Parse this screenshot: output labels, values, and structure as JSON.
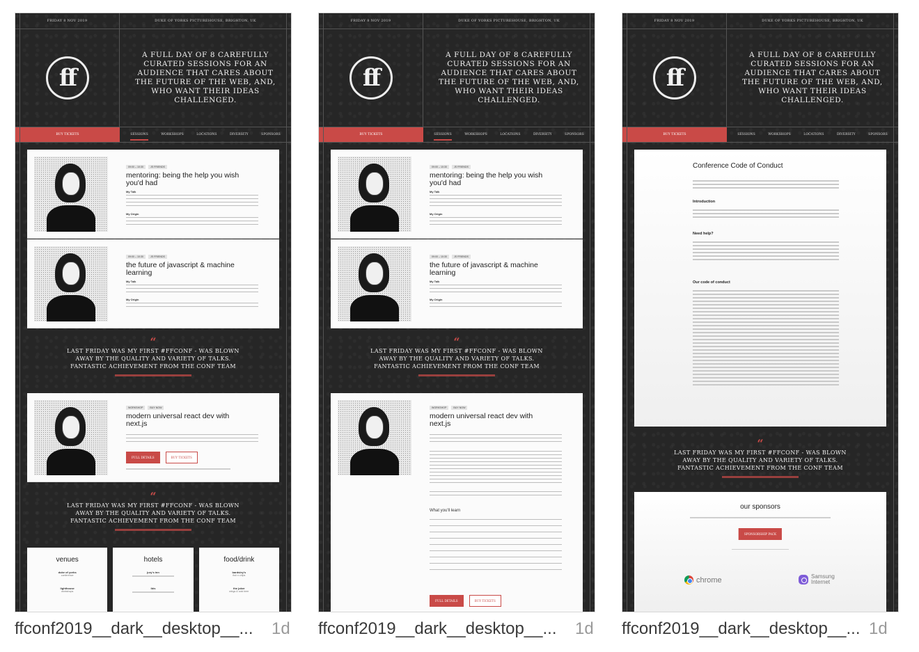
{
  "site": {
    "date": "FRIDAY 8 NOV 2019",
    "venue": "DUKE OF YORKS PICTUREHOUSE, BRIGHTON, UK",
    "logo": "ff",
    "tagline": "A FULL DAY OF 8 CAREFULLY CURATED SESSIONS FOR AN AUDIENCE THAT CARES ABOUT THE FUTURE OF THE WEB, AND, WHO WANT THEIR IDEAS CHALLENGED.",
    "buy_tickets": "BUY TICKETS",
    "nav": [
      "SESSIONS",
      "WORKSHOPS",
      "LOCATIONS",
      "DIVERSITY",
      "SPONSORS"
    ]
  },
  "talks": [
    {
      "tags": [
        "09:00 – 10:30",
        "JS FRIENDS"
      ],
      "title": "mentoring: being the help you wish you'd had",
      "talk_label": "My Talk",
      "origin_label": "My Origin"
    },
    {
      "tags": [
        "09:00 – 10:30",
        "JS FRIENDS"
      ],
      "title": "the future of javascript & machine learning",
      "talk_label": "My Talk",
      "origin_label": "My Origin"
    }
  ],
  "quote": {
    "mark": "“",
    "text": "LAST FRIDAY WAS MY FIRST #FFCONF - WAS BLOWN AWAY BY THE QUALITY AND VARIETY OF TALKS. FANTASTIC ACHIEVEMENT FROM THE CONF TEAM"
  },
  "workshop": {
    "tags": [
      "WORKSHOP",
      "BUY NOW"
    ],
    "title": "modern universal react dev with next.js",
    "full_details": "FULL DETAILS",
    "buy_tickets": "BUY TICKETS",
    "learn_heading": "What you'll learn"
  },
  "tiles": [
    {
      "heading": "venues",
      "items": [
        "duke of yorks",
        "lighthouse"
      ],
      "details": [
        "conference",
        "workshops"
      ]
    },
    {
      "heading": "hotels",
      "items": [
        "jury's inn",
        "ibis"
      ],
      "details": [],
      "details_hidden": true
    },
    {
      "heading": "food/drink",
      "items": [
        "bardsley's",
        "the joker"
      ],
      "details": [
        "fish n chips",
        "wings & cold beer"
      ]
    }
  ],
  "coc": {
    "title": "Conference Code of Conduct",
    "sections": [
      "Introduction",
      "Need help?",
      "Our code of conduct"
    ]
  },
  "sponsors": {
    "title": "our sponsors",
    "pack_button": "SPONSORSHIP PACK",
    "chrome": "chrome",
    "samsung": "Samsung Internet"
  },
  "captions": [
    {
      "name": "ffconf2019__dark__desktop__...",
      "age": "1d"
    },
    {
      "name": "ffconf2019__dark__desktop__...",
      "age": "1d"
    },
    {
      "name": "ffconf2019__dark__desktop__...",
      "age": "1d"
    }
  ],
  "colors": {
    "accent": "#c94a47",
    "dark_bg": "#262626",
    "panel": "#fbfbfb"
  }
}
